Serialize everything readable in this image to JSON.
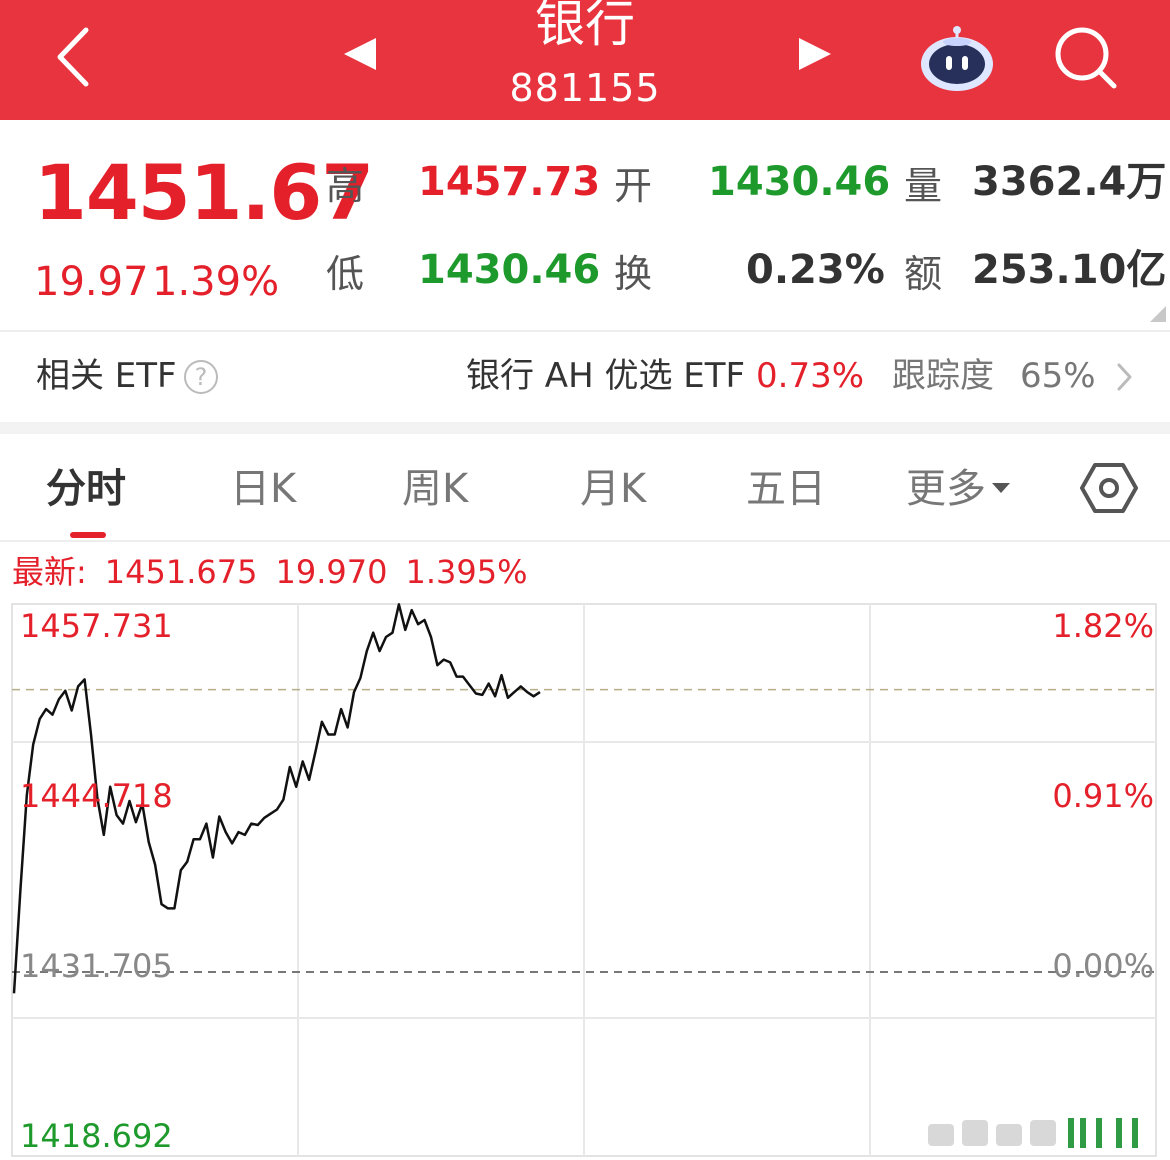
{
  "header": {
    "title": "银行",
    "code": "881155",
    "icons": [
      "back-arrow-icon",
      "prev-triangle-icon",
      "next-triangle-icon",
      "robot-assistant-icon",
      "search-icon"
    ],
    "color": "#e7343f"
  },
  "quote": {
    "price": "1451.67",
    "change": "19.97",
    "change_pct": "1.39%",
    "high_label": "高",
    "high": "1457.73",
    "low_label": "低",
    "low": "1430.46",
    "open_label": "开",
    "open": "1430.46",
    "turnover_label": "换",
    "turnover": "0.23%",
    "volume_label": "量",
    "volume": "3362.4万",
    "amount_label": "额",
    "amount": "253.10亿",
    "up_color": "#e4202b",
    "down_color": "#1d9a2b"
  },
  "etf": {
    "label": "相关 ETF",
    "help": "?",
    "name": "银行 AH 优选 ETF",
    "pct": "0.73%",
    "track_label": "跟踪度",
    "track_value": "65%"
  },
  "tabs": [
    {
      "label": "分时",
      "active": true
    },
    {
      "label": "日K",
      "active": false
    },
    {
      "label": "周K",
      "active": false
    },
    {
      "label": "月K",
      "active": false
    },
    {
      "label": "五日",
      "active": false
    },
    {
      "label": "更多",
      "active": false
    }
  ],
  "latest": {
    "label": "最新:",
    "price": "1451.675",
    "change": "19.970",
    "change_pct": "1.395%"
  },
  "chart_data": {
    "type": "line",
    "title": "",
    "y_left_ticks": [
      "1457.731",
      "1444.718",
      "1431.705",
      "1418.692"
    ],
    "y_right_ticks": [
      "1.82%",
      "0.91%",
      "0.00%"
    ],
    "ylim": [
      1418.692,
      1457.731
    ],
    "prev_close": 1431.705,
    "reference_dashed": 1451.675,
    "x_points_total": 240,
    "grid": true,
    "series": [
      {
        "values": [
          1430.2,
          1437.5,
          1444.2,
          1447.8,
          1449.6,
          1450.3,
          1449.9,
          1451.0,
          1451.6,
          1450.2,
          1451.9,
          1452.4,
          1448.5,
          1444.0,
          1441.4,
          1444.8,
          1442.8,
          1442.2,
          1443.8,
          1442.3,
          1443.6,
          1440.9,
          1439.3,
          1436.5,
          1436.2,
          1436.2,
          1438.9,
          1439.5,
          1441.1,
          1441.1,
          1442.2,
          1439.8,
          1442.7,
          1441.6,
          1440.8,
          1441.6,
          1441.4,
          1442.2,
          1442.1,
          1442.6,
          1442.9,
          1443.2,
          1443.9,
          1446.2,
          1444.8,
          1446.6,
          1445.3,
          1447.3,
          1449.4,
          1448.5,
          1448.5,
          1450.3,
          1449.0,
          1451.5,
          1452.5,
          1454.4,
          1455.7,
          1454.4,
          1455.4,
          1455.7,
          1457.7,
          1455.9,
          1457.3,
          1456.3,
          1456.6,
          1455.4,
          1453.4,
          1453.8,
          1453.6,
          1452.6,
          1452.6,
          1452.0,
          1451.4,
          1451.3,
          1452.1,
          1451.2,
          1452.7,
          1451.1,
          1451.5,
          1451.9,
          1451.5,
          1451.2,
          1451.5
        ]
      }
    ]
  }
}
